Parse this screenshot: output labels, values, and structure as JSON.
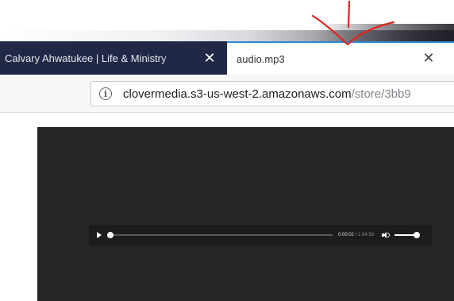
{
  "tabs": [
    {
      "title": "Calvary Ahwatukee | Life & Ministry",
      "close_glyph": "✕",
      "active": false
    },
    {
      "title": "audio.mp3",
      "close_glyph": "✕",
      "active": true
    }
  ],
  "address_bar": {
    "info_glyph": "i",
    "url_host": "clovermedia.s3-us-west-2.amazonaws.com",
    "url_path": "/store/3bb9"
  },
  "player": {
    "current_time": "0:00:02",
    "separator": " / ",
    "duration": "1:04:58",
    "progress_fraction": 0.0,
    "volume_fraction": 1.0,
    "icons": [
      "play-icon",
      "volume-icon"
    ]
  },
  "colors": {
    "inactive_tab": "#202846",
    "active_tab_accent": "#2f86d6",
    "viewport_bg": "#262626",
    "player_bg": "#1c1c1c",
    "annotation": "#e0241c"
  }
}
